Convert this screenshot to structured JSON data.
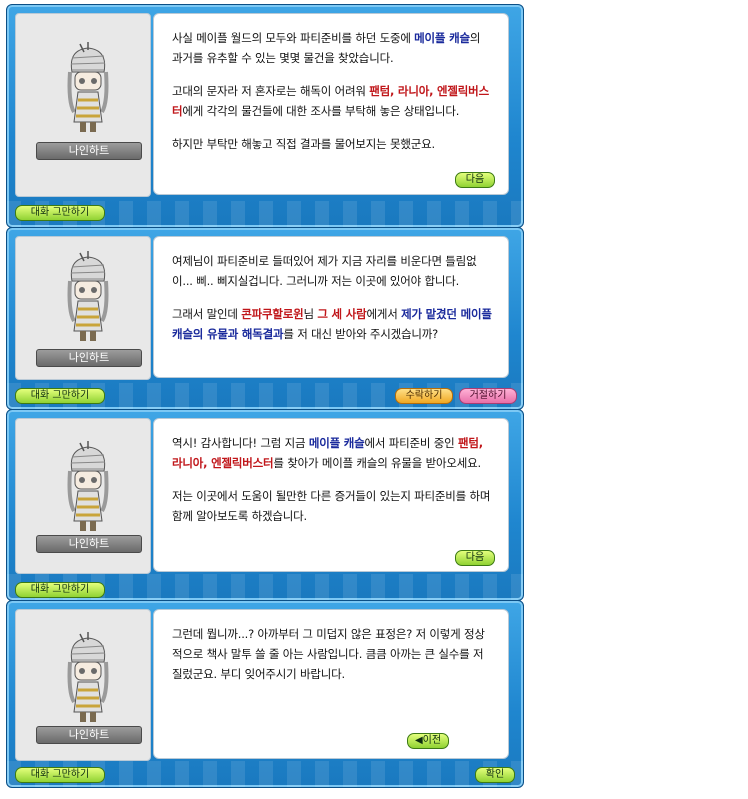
{
  "npc_name": "나인하트",
  "buttons": {
    "end_chat": "대화 그만하기",
    "next": "다음",
    "accept": "수락하기",
    "decline": "거절하기",
    "prev": "이전",
    "ok": "확인"
  },
  "dialogs": [
    {
      "p1": [
        "사실 메이플 월드의 모두와 파티준비를 하던 도중에 ",
        "메이플 캐슬",
        "의 과거를 유추할 수 있는 몇몇 물건을 찾았습니다."
      ],
      "p2": [
        "고대의 문자라 저 혼자로는 해독이 어려워 ",
        "팬텀, 라니아, 엔젤릭버스터",
        "에게 각각의 물건들에 대한 조사를 부탁해 놓은 상태입니다."
      ],
      "p3": [
        "하지만 부탁만 해놓고 직접 결과를 물어보지는 못했군요."
      ]
    },
    {
      "p1": [
        "여제님이 파티준비로 들떠있어 제가 지금 자리를 비운다면 틀림없이... 삐.. 삐지실겁니다. 그러니까 저는 이곳에 있어야 합니다."
      ],
      "p2": [
        "그래서 말인데 ",
        "콘파쿠할로윈",
        "님 ",
        "그 세 사람",
        "에게서 ",
        "제가 맡겼던 메이플 캐슬의 유물과 해독결과",
        "를 저 대신 받아와 주시겠습니까?"
      ]
    },
    {
      "p1": [
        "역시! 감사합니다! 그럼 지금 ",
        "메이플 캐슬",
        "에서 파티준비 중인 ",
        "팬텀, 라니아, 엔젤릭버스터",
        "를 찾아가 메이플 캐슬의 유물을 받아오세요."
      ],
      "p2": [
        "저는 이곳에서 도움이 될만한 다른 증거들이 있는지 파티준비를 하며 함께 알아보도록 하겠습니다."
      ]
    },
    {
      "p1": [
        "그런데 뭡니까...? 아까부터 그 미덥지 않은 표정은? 저 이렇게 정상적으로 책사 말투 쓸 줄 아는 사람입니다. 큼큼 아까는 큰 실수를 저질렀군요. 부디 잊어주시기 바랍니다."
      ]
    }
  ]
}
